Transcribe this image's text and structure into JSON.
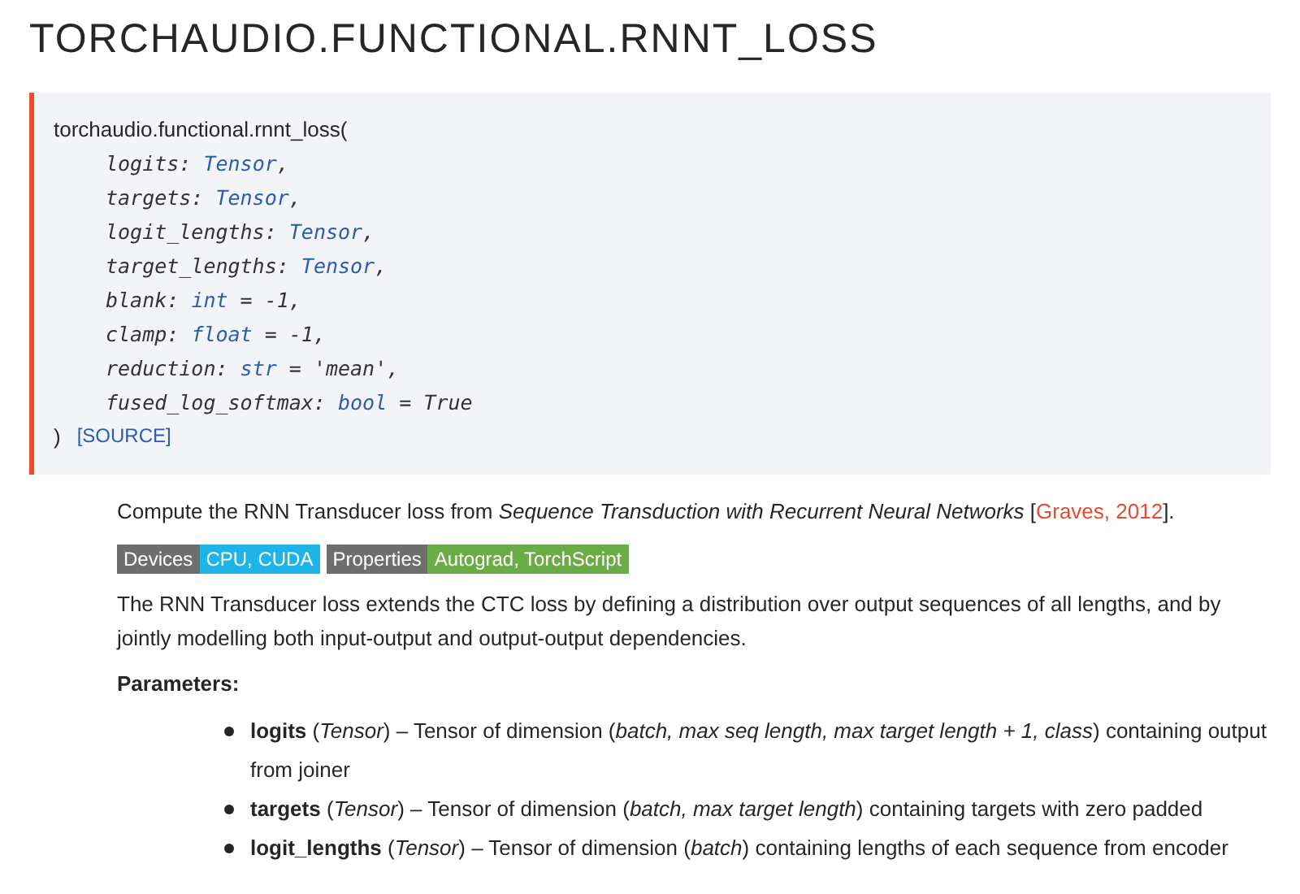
{
  "title": "TORCHAUDIO.FUNCTIONAL.RNNT_LOSS",
  "signature": {
    "name": "torchaudio.functional.rnnt_loss(",
    "close": ")",
    "source_link": "[SOURCE]",
    "params": [
      {
        "name": "logits: ",
        "type": "Tensor",
        "rest": ","
      },
      {
        "name": "targets: ",
        "type": "Tensor",
        "rest": ","
      },
      {
        "name": "logit_lengths: ",
        "type": "Tensor",
        "rest": ","
      },
      {
        "name": "target_lengths: ",
        "type": "Tensor",
        "rest": ","
      },
      {
        "name": "blank: ",
        "type": "int",
        "rest": " = -1,"
      },
      {
        "name": "clamp: ",
        "type": "float",
        "rest": " = -1,"
      },
      {
        "name": "reduction: ",
        "type": "str",
        "rest": " = 'mean',"
      },
      {
        "name": "fused_log_softmax: ",
        "type": "bool",
        "rest": " = True"
      }
    ]
  },
  "summary": {
    "text": "Compute the RNN Transducer loss from *Sequence Transduction with Recurrent Neural Networks* [",
    "link": "Graves, 2012",
    "tail": "]."
  },
  "badges": [
    {
      "label": "Devices",
      "value": "CPU, CUDA",
      "color": "#1fb4e9"
    },
    {
      "label": "Properties",
      "value": "Autograd, TorchScript",
      "color": "#6aac45"
    }
  ],
  "description": "The RNN Transducer loss extends the CTC loss by defining a distribution over output sequences of all lengths, and by jointly modelling both input-output and output-output dependencies.",
  "parameters_heading": "Parameters:",
  "parameters": [
    "**logits** (*Tensor*) – Tensor of dimension (*batch, max seq length, max target length + 1, class*) containing output from joiner",
    "**targets** (*Tensor*) – Tensor of dimension (*batch, max target length*) containing targets with zero padded",
    "**logit_lengths** (*Tensor*) – Tensor of dimension (*batch*) containing lengths of each sequence from encoder"
  ]
}
